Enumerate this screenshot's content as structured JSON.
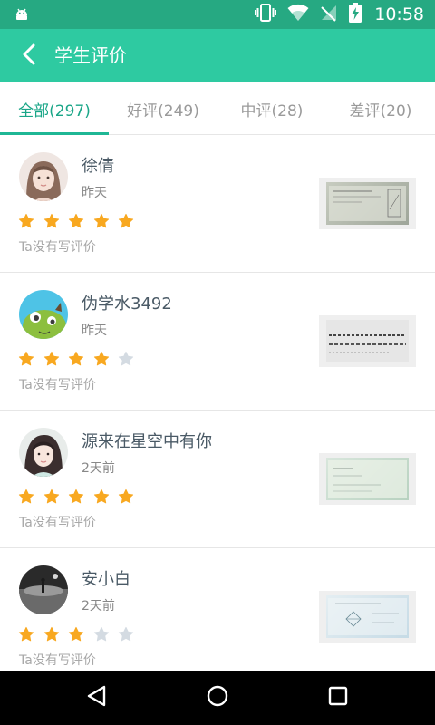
{
  "status_bar": {
    "time": "10:58",
    "icons": [
      "android-icon",
      "vibrate-icon",
      "wifi-icon",
      "no-signal-icon",
      "battery-charging-icon"
    ]
  },
  "app_bar": {
    "title": "学生评价",
    "back_icon": "back-arrow-icon",
    "background": "#2ecaa1"
  },
  "tabs": [
    {
      "label": "全部(297)",
      "active": true
    },
    {
      "label": "好评(249)",
      "active": false
    },
    {
      "label": "中评(28)",
      "active": false
    },
    {
      "label": "差评(20)",
      "active": false
    }
  ],
  "accent_color": "#1fb795",
  "star_colors": {
    "filled": "#f8a820",
    "empty": "#d4dbe2"
  },
  "reviews": [
    {
      "name": "徐倩",
      "time": "昨天",
      "rating": 5,
      "max_rating": 5,
      "comment": "Ta没有写评价",
      "avatar": "girl-photo-avatar",
      "thumbnail": "homework-photo"
    },
    {
      "name": "伪学水3492",
      "time": "昨天",
      "rating": 4,
      "max_rating": 5,
      "comment": "Ta没有写评价",
      "avatar": "green-cartoon-avatar",
      "thumbnail": "homework-photo"
    },
    {
      "name": "源来在星空中有你",
      "time": "2天前",
      "rating": 5,
      "max_rating": 5,
      "comment": "Ta没有写评价",
      "avatar": "girl-photo-avatar",
      "thumbnail": "homework-photo"
    },
    {
      "name": "安小白",
      "time": "2天前",
      "rating": 3,
      "max_rating": 5,
      "comment": "Ta没有写评价",
      "avatar": "dark-scene-avatar",
      "thumbnail": "homework-photo"
    }
  ],
  "nav_bar": {
    "buttons": [
      "back-triangle-icon",
      "home-circle-icon",
      "recents-square-icon"
    ]
  }
}
